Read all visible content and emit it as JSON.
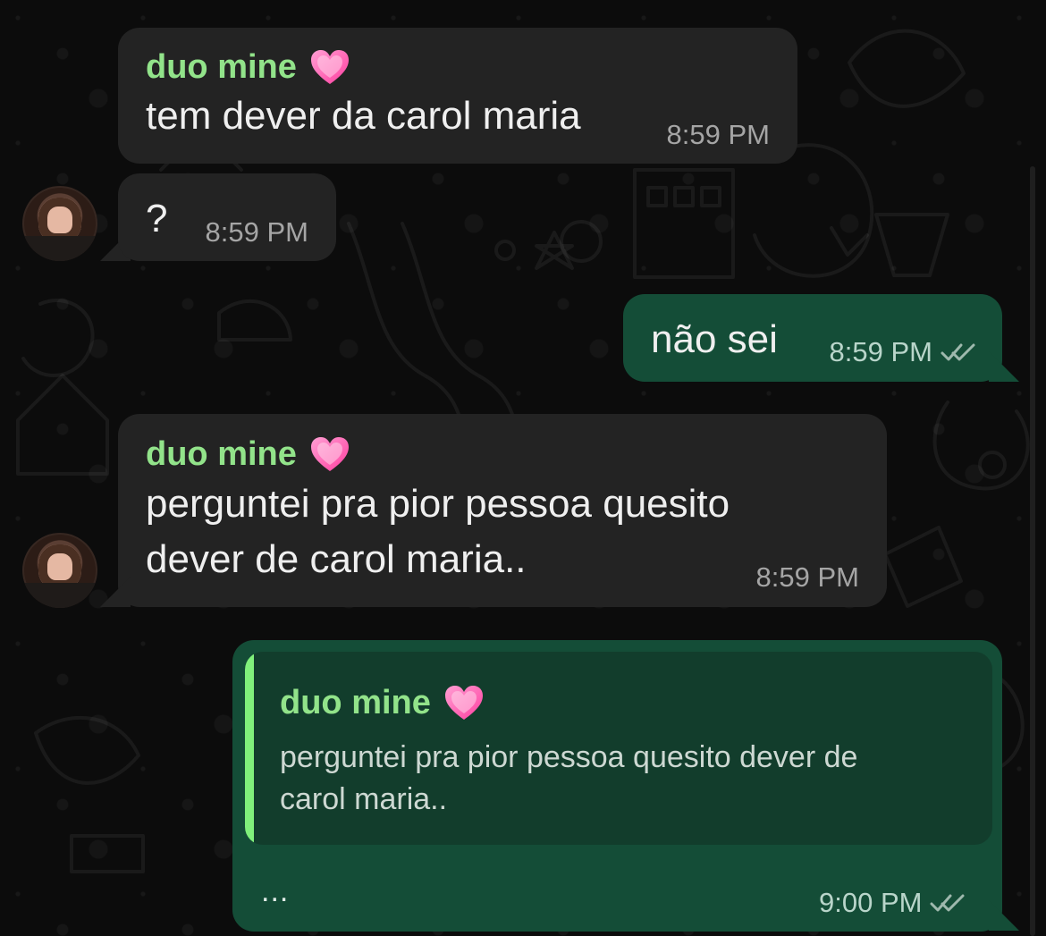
{
  "chat": {
    "messages": [
      {
        "sender": "duo mine",
        "text": "tem dever da carol maria",
        "time": "8:59 PM"
      },
      {
        "text": "?",
        "time": "8:59 PM"
      },
      {
        "text": "não sei",
        "time": "8:59 PM"
      },
      {
        "sender": "duo mine",
        "text": "perguntei pra pior pessoa quesito\ndever de carol maria..",
        "time": "8:59 PM"
      },
      {
        "reply_sender": "duo mine",
        "reply_text": "perguntei pra pior pessoa quesito dever de\ncarol maria..",
        "body": "...",
        "time": "9:00 PM"
      }
    ]
  },
  "icons": {
    "heart": "heart-icon",
    "double_check": "double-check-icon",
    "avatar": "avatar"
  },
  "colors": {
    "background": "#0c0c0c",
    "incoming_bubble": "#232323",
    "outgoing_bubble": "#144d37",
    "sender_name": "#92e38a",
    "reply_bar": "#80f07b"
  }
}
